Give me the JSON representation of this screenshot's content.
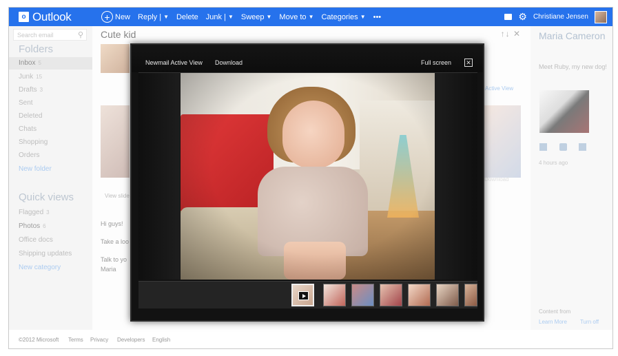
{
  "app": {
    "name": "Outlook",
    "logo_letter": "o"
  },
  "toolbar": {
    "new": "New",
    "reply": "Reply |",
    "delete": "Delete",
    "junk": "Junk |",
    "sweep": "Sweep",
    "move_to": "Move to",
    "categories": "Categories",
    "more": "•••",
    "user_name": "Christiane Jensen"
  },
  "search": {
    "placeholder": "Search email"
  },
  "folders": {
    "heading": "Folders",
    "items": [
      {
        "label": "Inbox",
        "count": "5"
      },
      {
        "label": "Junk",
        "count": "15"
      },
      {
        "label": "Drafts",
        "count": "3"
      },
      {
        "label": "Sent",
        "count": ""
      },
      {
        "label": "Deleted",
        "count": ""
      },
      {
        "label": "Chats",
        "count": ""
      },
      {
        "label": "Shopping",
        "count": ""
      },
      {
        "label": "Orders",
        "count": ""
      }
    ],
    "new_folder": "New folder"
  },
  "quick_views": {
    "heading": "Quick views",
    "items": [
      {
        "label": "Flagged",
        "count": "3"
      },
      {
        "label": "Photos",
        "count": "6"
      },
      {
        "label": "Office docs",
        "count": ""
      },
      {
        "label": "Shipping updates",
        "count": ""
      }
    ],
    "new_category": "New category"
  },
  "message": {
    "subject": "Cute kid",
    "arrows": "↑↓ ✕",
    "active_view": "Active View",
    "view_slides": "View slide",
    "download": "Download",
    "body_lines": [
      "Hi guys!",
      "Take a loo",
      "Talk to yo",
      "Maria"
    ]
  },
  "viewer": {
    "title": "Newmail Active View",
    "download": "Download",
    "fullscreen": "Full screen",
    "close": "✕"
  },
  "people": {
    "name": "Maria Cameron",
    "message": "Meet Ruby, my new dog!",
    "time": "4 hours ago",
    "content_from": "Content from",
    "learn_more": "Learn More",
    "turn_off": "Turn off"
  },
  "footer": {
    "copyright": "©2012 Microsoft",
    "terms": "Terms",
    "privacy": "Privacy",
    "developers": "Developers",
    "language": "English"
  }
}
